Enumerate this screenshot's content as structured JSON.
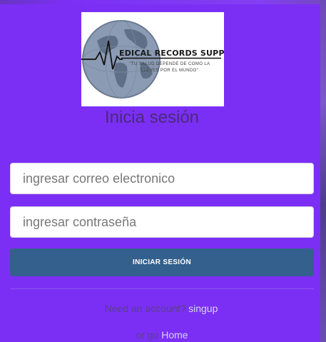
{
  "logo": {
    "brand": "EDICAL RECORDS SUPPORT",
    "tagline": "\"TU SALUD DEPENDE DE COMO LA LLEVES POR EL MUNDO\""
  },
  "login": {
    "title": "Inicia sesión",
    "email_placeholder": "ingresar correo electronico",
    "password_placeholder": "ingresar contraseña",
    "submit_label": "INICIAR SESIÓN"
  },
  "footer": {
    "need_account_text": "Need an account?",
    "signup_link": "singup",
    "or_go_text": "or go",
    "home_link": "Home"
  },
  "colors": {
    "background": "#7b2ff5",
    "button": "#33608c",
    "title_text": "#4b2a78"
  }
}
